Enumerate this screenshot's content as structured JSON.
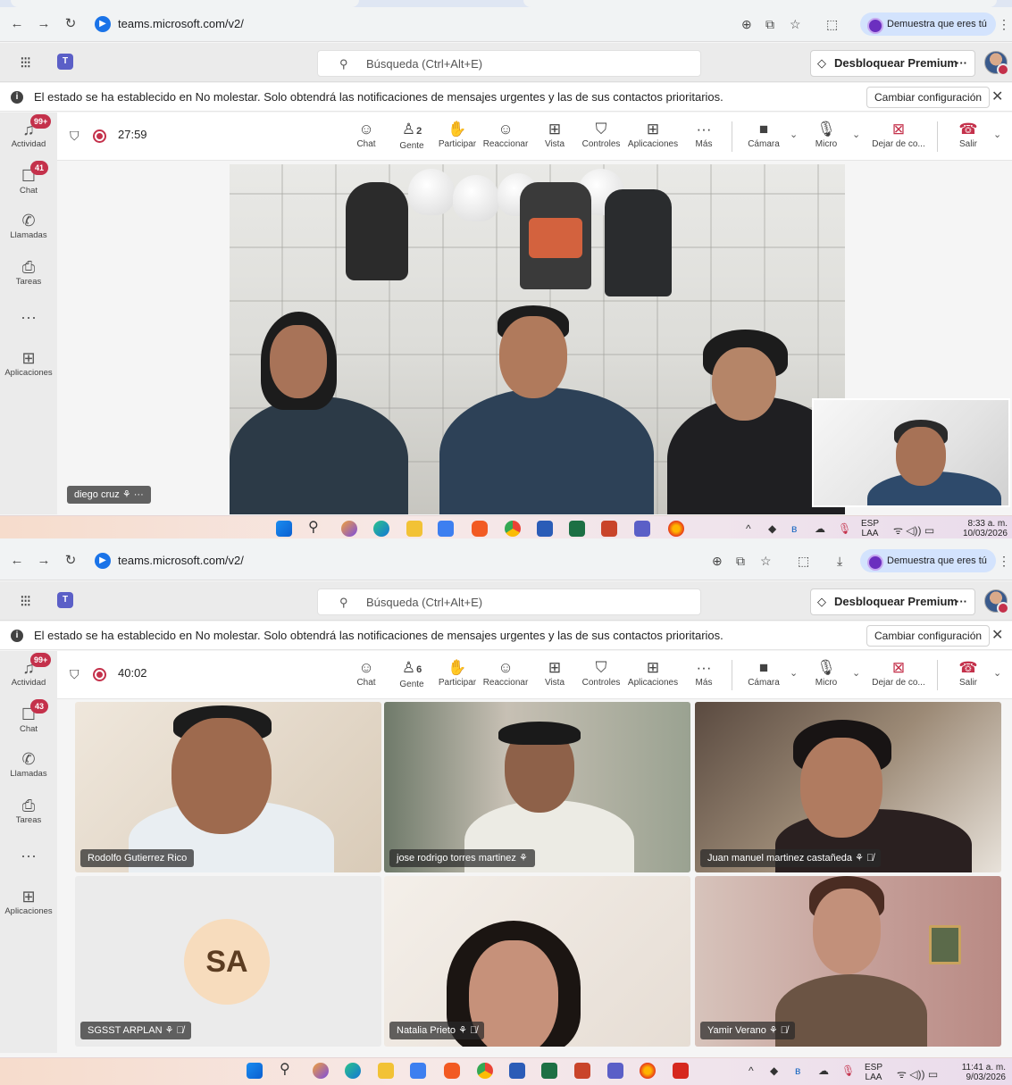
{
  "screen1": {
    "browser": {
      "url": "teams.microsoft.com/v2/",
      "profile_label": "Demuestra que eres tú"
    },
    "teams": {
      "search_placeholder": "Búsqueda (Ctrl+Alt+E)",
      "premium_label": "Desbloquear Premium",
      "notice_text": "El estado se ha establecido en No molestar. Solo obtendrá las notificaciones de mensajes urgentes y las de sus contactos prioritarios.",
      "notice_button": "Cambiar configuración"
    },
    "rail": [
      {
        "label": "Actividad",
        "badge": "99+"
      },
      {
        "label": "Chat",
        "badge": "41"
      },
      {
        "label": "Llamadas",
        "badge": ""
      },
      {
        "label": "Tareas",
        "badge": ""
      },
      {
        "label": "",
        "badge": ""
      },
      {
        "label": "Aplicaciones",
        "badge": ""
      }
    ],
    "meeting": {
      "timer": "27:59",
      "controls": [
        "Chat",
        "Gente",
        "Participar",
        "Reaccionar",
        "Vista",
        "Controles",
        "Aplicaciones",
        "Más",
        "Cámara",
        "Micro",
        "Dejar de co...",
        "Salir"
      ],
      "people_count": "2"
    },
    "main_participant": "diego cruz",
    "taskbar": {
      "lang": "ESP",
      "lang2": "LAA",
      "time": "8:33 a. m.",
      "date": "10/03/2026"
    }
  },
  "screen2": {
    "browser": {
      "url": "teams.microsoft.com/v2/",
      "profile_label": "Demuestra que eres tú"
    },
    "teams": {
      "search_placeholder": "Búsqueda (Ctrl+Alt+E)",
      "premium_label": "Desbloquear Premium",
      "notice_text": "El estado se ha establecido en No molestar. Solo obtendrá las notificaciones de mensajes urgentes y las de sus contactos prioritarios.",
      "notice_button": "Cambiar configuración"
    },
    "rail": [
      {
        "label": "Actividad",
        "badge": "99+"
      },
      {
        "label": "Chat",
        "badge": "43"
      },
      {
        "label": "Llamadas",
        "badge": ""
      },
      {
        "label": "Tareas",
        "badge": ""
      },
      {
        "label": "",
        "badge": ""
      },
      {
        "label": "Aplicaciones",
        "badge": ""
      }
    ],
    "meeting": {
      "timer": "40:02",
      "controls": [
        "Chat",
        "Gente",
        "Participar",
        "Reaccionar",
        "Vista",
        "Controles",
        "Aplicaciones",
        "Más",
        "Cámara",
        "Micro",
        "Dejar de co...",
        "Salir"
      ],
      "people_count": "6"
    },
    "participants": [
      {
        "name": "Rodolfo Gutierrez Rico"
      },
      {
        "name": "jose rodrigo torres martinez"
      },
      {
        "name": "Juan manuel martinez castañeda"
      },
      {
        "name": "SGSST ARPLAN",
        "initials": "SA"
      },
      {
        "name": "Natalia Prieto"
      },
      {
        "name": "Yamir Verano"
      }
    ],
    "taskbar": {
      "lang": "ESP",
      "lang2": "LAA",
      "time": "11:41 a. m.",
      "date": "9/03/2026"
    }
  },
  "colors": {
    "accent": "#5b5fc7",
    "leave": "#c4314b",
    "badge": "#c4314b"
  }
}
